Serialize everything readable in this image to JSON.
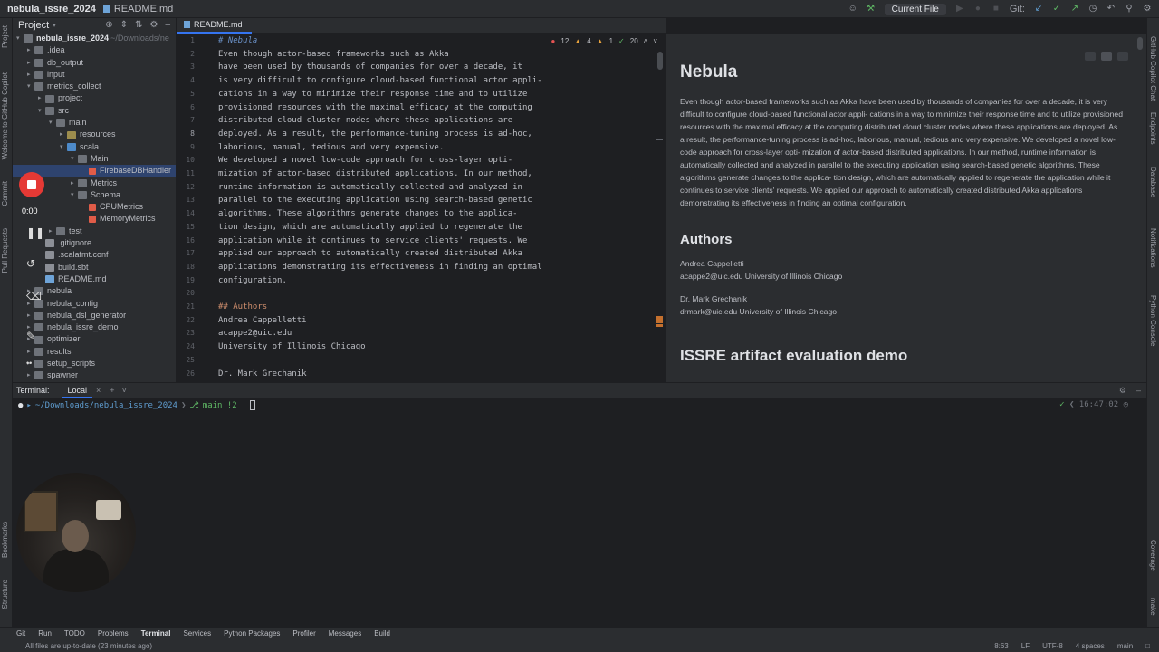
{
  "titlebar": {
    "project": "nebula_issre_2024",
    "file": "README.md",
    "run_config": "Current File",
    "git_label": "Git:"
  },
  "left_strip": [
    "Project",
    "Welcome to GitHub Copilot",
    "Commit",
    "Pull Requests",
    "Bookmarks",
    "Structure"
  ],
  "right_strip": [
    "GitHub Copilot Chat",
    "Endpoints",
    "Database",
    "Notifications",
    "Python Console",
    "Coverage",
    "make"
  ],
  "project_panel": {
    "title": "Project",
    "root_name": "nebula_issre_2024",
    "root_path": "~/Downloads/ne",
    "items": [
      {
        "label": ".idea",
        "depth": 1,
        "type": "folder",
        "arrow": "▸"
      },
      {
        "label": "db_output",
        "depth": 1,
        "type": "folder",
        "arrow": "▸"
      },
      {
        "label": "input",
        "depth": 1,
        "type": "folder",
        "arrow": "▸"
      },
      {
        "label": "metrics_collect",
        "depth": 1,
        "type": "folder",
        "arrow": "▾"
      },
      {
        "label": "project",
        "depth": 2,
        "type": "folder",
        "arrow": "▸"
      },
      {
        "label": "src",
        "depth": 2,
        "type": "folder",
        "arrow": "▾"
      },
      {
        "label": "main",
        "depth": 3,
        "type": "folder",
        "arrow": "▾"
      },
      {
        "label": "resources",
        "depth": 4,
        "type": "res",
        "arrow": "▸"
      },
      {
        "label": "scala",
        "depth": 4,
        "type": "src",
        "arrow": "▾"
      },
      {
        "label": "Main",
        "depth": 5,
        "type": "folder",
        "arrow": "▾"
      },
      {
        "label": "FirebaseDBHandler",
        "depth": 6,
        "type": "scala",
        "arrow": "",
        "selected": true
      },
      {
        "label": "Metrics",
        "depth": 5,
        "type": "folder",
        "arrow": "▸"
      },
      {
        "label": "Schema",
        "depth": 5,
        "type": "folder",
        "arrow": "▾"
      },
      {
        "label": "CPUMetrics",
        "depth": 6,
        "type": "scala",
        "arrow": ""
      },
      {
        "label": "MemoryMetrics",
        "depth": 6,
        "type": "scala",
        "arrow": ""
      },
      {
        "label": "test",
        "depth": 3,
        "type": "folder",
        "arrow": "▸"
      },
      {
        "label": ".gitignore",
        "depth": 2,
        "type": "misc",
        "arrow": ""
      },
      {
        "label": ".scalafmt.conf",
        "depth": 2,
        "type": "misc",
        "arrow": ""
      },
      {
        "label": "build.sbt",
        "depth": 2,
        "type": "misc",
        "arrow": ""
      },
      {
        "label": "README.md",
        "depth": 2,
        "type": "md",
        "arrow": ""
      },
      {
        "label": "nebula",
        "depth": 1,
        "type": "folder",
        "arrow": "▸"
      },
      {
        "label": "nebula_config",
        "depth": 1,
        "type": "folder",
        "arrow": "▸"
      },
      {
        "label": "nebula_dsl_generator",
        "depth": 1,
        "type": "folder",
        "arrow": "▸"
      },
      {
        "label": "nebula_issre_demo",
        "depth": 1,
        "type": "folder",
        "arrow": "▸"
      },
      {
        "label": "optimizer",
        "depth": 1,
        "type": "folder",
        "arrow": "▸"
      },
      {
        "label": "results",
        "depth": 1,
        "type": "folder",
        "arrow": "▸"
      },
      {
        "label": "setup_scripts",
        "depth": 1,
        "type": "folder",
        "arrow": "▸"
      },
      {
        "label": "spawner",
        "depth": 1,
        "type": "folder",
        "arrow": "▸"
      }
    ]
  },
  "editor": {
    "tab": "README.md",
    "inspections": {
      "errors": "12",
      "warnings": "4",
      "weak": "1",
      "typos": "20"
    },
    "lines": [
      {
        "n": "1",
        "text": "# Nebula",
        "kind": "h1"
      },
      {
        "n": "2",
        "text": "Even though actor-based frameworks such as Akka",
        "kind": ""
      },
      {
        "n": "3",
        "text": "have been used by thousands of companies for over a decade, it",
        "kind": ""
      },
      {
        "n": "4",
        "text": "is very difficult to configure cloud-based functional actor appli-",
        "kind": ""
      },
      {
        "n": "5",
        "text": "cations in a way to minimize their response time and to utilize",
        "kind": ""
      },
      {
        "n": "6",
        "text": "provisioned resources with the maximal efficacy at the computing",
        "kind": ""
      },
      {
        "n": "7",
        "text": "distributed cloud cluster nodes where these applications are",
        "kind": ""
      },
      {
        "n": "8",
        "text": "deployed. As a result, the performance-tuning process is ad-hoc,",
        "kind": ""
      },
      {
        "n": "9",
        "text": "laborious, manual, tedious and very expensive.",
        "kind": ""
      },
      {
        "n": "10",
        "text": "We developed a novel low-code approach for cross-layer opti-",
        "kind": ""
      },
      {
        "n": "11",
        "text": "mization of actor-based distributed applications. In our method,",
        "kind": ""
      },
      {
        "n": "12",
        "text": "runtime information is automatically collected and analyzed in",
        "kind": ""
      },
      {
        "n": "13",
        "text": "parallel to the executing application using search-based genetic",
        "kind": ""
      },
      {
        "n": "14",
        "text": "algorithms. These algorithms generate changes to the applica-",
        "kind": ""
      },
      {
        "n": "15",
        "text": "tion design, which are automatically applied to regenerate the",
        "kind": ""
      },
      {
        "n": "16",
        "text": "application while it continues to service clients' requests. We",
        "kind": ""
      },
      {
        "n": "17",
        "text": "applied our approach to automatically created distributed Akka",
        "kind": ""
      },
      {
        "n": "18",
        "text": "applications demonstrating its effectiveness in finding an optimal",
        "kind": ""
      },
      {
        "n": "19",
        "text": "configuration.",
        "kind": ""
      },
      {
        "n": "20",
        "text": "",
        "kind": ""
      },
      {
        "n": "21",
        "text": "## Authors",
        "kind": "h2"
      },
      {
        "n": "22",
        "text": "Andrea Cappelletti",
        "kind": ""
      },
      {
        "n": "23",
        "text": "acappe2@uic.edu",
        "kind": ""
      },
      {
        "n": "24",
        "text": "University of Illinois Chicago",
        "kind": ""
      },
      {
        "n": "25",
        "text": "",
        "kind": ""
      },
      {
        "n": "26",
        "text": "Dr. Mark Grechanik",
        "kind": ""
      }
    ]
  },
  "preview": {
    "title": "Nebula",
    "paragraph": "Even though actor-based frameworks such as Akka have been used by thousands of companies for over a decade, it is very difficult to configure cloud-based functional actor appli- cations in a way to minimize their response time and to utilize provisioned resources with the maximal efficacy at the computing distributed cloud cluster nodes where these applications are deployed. As a result, the performance-tuning process is ad-hoc, laborious, manual, tedious and very expensive. We developed a novel low-code approach for cross-layer opti- mization of actor-based distributed applications. In our method, runtime information is automatically collected and analyzed in parallel to the executing application using search-based genetic algorithms. These algorithms generate changes to the applica- tion design, which are automatically applied to regenerate the application while it continues to service clients' requests. We applied our approach to automatically created distributed Akka applications demonstrating its effectiveness in finding an optimal configuration.",
    "authors_heading": "Authors",
    "author1_name": "Andrea Cappelletti",
    "author1_line": "acappe2@uic.edu University of Illinois Chicago",
    "author2_name": "Dr. Mark Grechanik",
    "author2_line": "drmark@uic.edu University of Illinois Chicago",
    "next_heading": "ISSRE artifact evaluation demo"
  },
  "terminal": {
    "title": "Terminal:",
    "tab": "Local",
    "path": "~/Downloads/nebula_issre_2024",
    "branch": "main !2",
    "time": "16:47:02"
  },
  "recorder": {
    "time": "0:00"
  },
  "toolbar": [
    "Git",
    "Run",
    "TODO",
    "Problems",
    "Terminal",
    "Services",
    "Python Packages",
    "Profiler",
    "Messages",
    "Build"
  ],
  "status": {
    "message": "All files are up-to-date (23 minutes ago)",
    "position": "8:63",
    "line_sep": "LF",
    "encoding": "UTF-8",
    "indent": "4 spaces",
    "branch": "main"
  },
  "colors": {
    "accent": "#3574f0",
    "record": "#e53935",
    "error": "#e55353",
    "warning": "#e8a33d"
  }
}
